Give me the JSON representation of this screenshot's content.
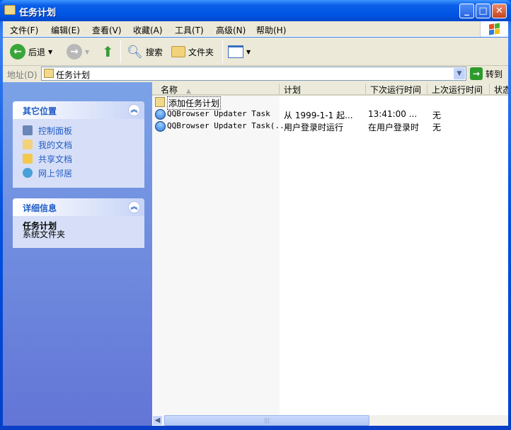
{
  "window": {
    "title": "任务计划"
  },
  "menu": [
    "文件(F)",
    "编辑(E)",
    "查看(V)",
    "收藏(A)",
    "工具(T)",
    "高级(N)",
    "帮助(H)"
  ],
  "toolbar": {
    "back": "后退",
    "search": "搜索",
    "folders": "文件夹"
  },
  "address": {
    "label": "地址(D)",
    "value": "任务计划",
    "go": "转到"
  },
  "other_places": {
    "title": "其它位置",
    "items": [
      "控制面板",
      "我的文档",
      "共享文档",
      "网上邻居"
    ]
  },
  "details": {
    "title": "详细信息",
    "name": "任务计划",
    "type": "系统文件夹"
  },
  "columns": [
    "名称",
    "计划",
    "下次运行时间",
    "上次运行时间",
    "状态"
  ],
  "rows": [
    {
      "name": "添加任务计划",
      "schedule": "",
      "next": "",
      "last": ""
    },
    {
      "name": "QQBrowser Updater Task",
      "schedule": "从 1999-1-1 起...",
      "next": "13:41:00  ...",
      "last": "无"
    },
    {
      "name": "QQBrowser Updater Task(...",
      "schedule": "用户登录时运行",
      "next": "在用户登录时",
      "last": "无"
    }
  ]
}
